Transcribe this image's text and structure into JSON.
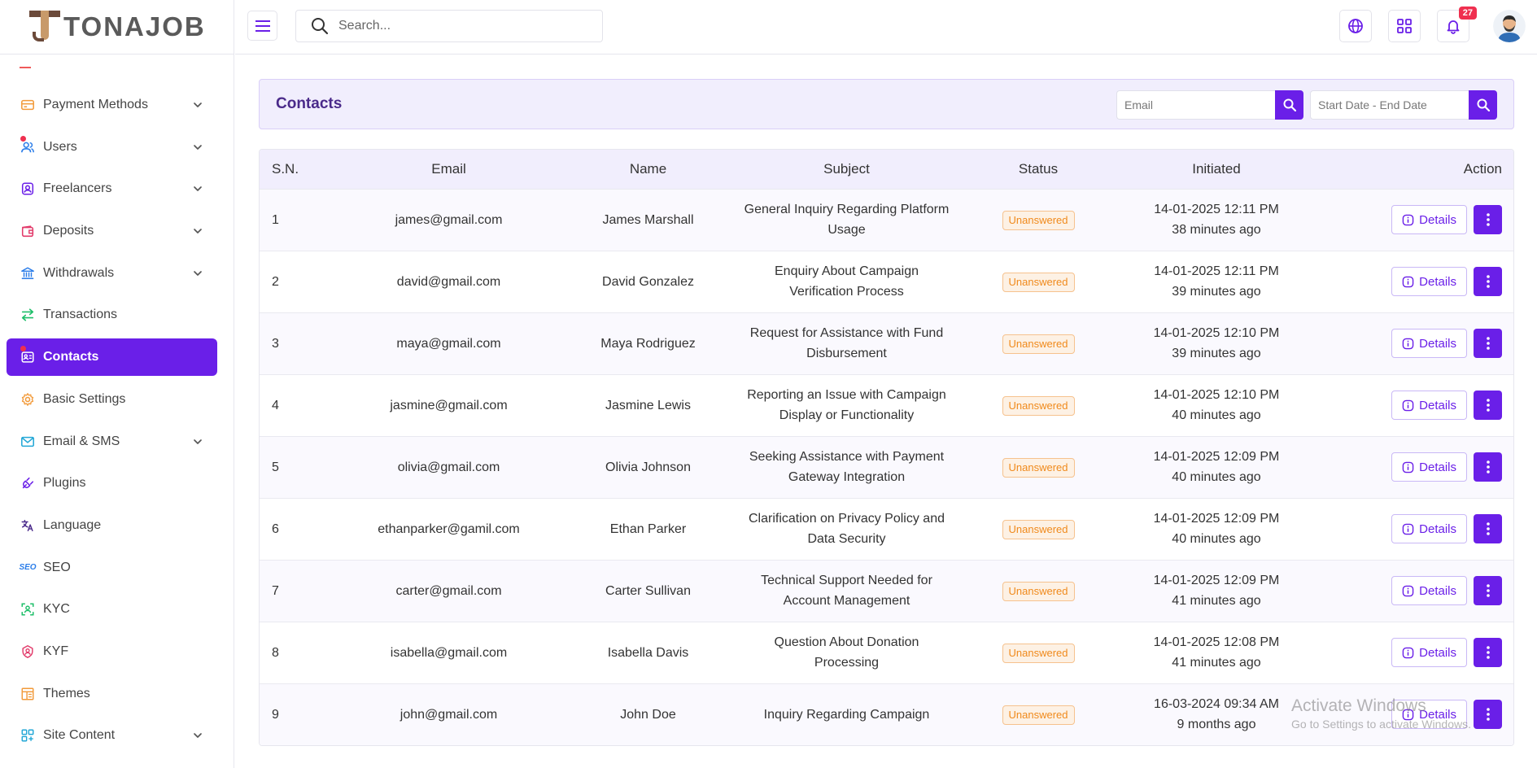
{
  "brand": {
    "logo_text": "TONAJOB"
  },
  "topbar": {
    "search_placeholder": "Search...",
    "notification_count": "27"
  },
  "sidebar": {
    "items": [
      {
        "label": "Payment Methods",
        "icon": "credit-card-icon",
        "chevron": true,
        "active": false,
        "dot": false
      },
      {
        "label": "Users",
        "icon": "users-icon",
        "chevron": true,
        "active": false,
        "dot": true
      },
      {
        "label": "Freelancers",
        "icon": "freelancer-icon",
        "chevron": true,
        "active": false,
        "dot": false
      },
      {
        "label": "Deposits",
        "icon": "wallet-icon",
        "chevron": true,
        "active": false,
        "dot": false
      },
      {
        "label": "Withdrawals",
        "icon": "bank-icon",
        "chevron": true,
        "active": false,
        "dot": false
      },
      {
        "label": "Transactions",
        "icon": "transfer-icon",
        "chevron": false,
        "active": false,
        "dot": false
      },
      {
        "label": "Contacts",
        "icon": "contact-icon",
        "chevron": false,
        "active": true,
        "dot": true
      },
      {
        "label": "Basic Settings",
        "icon": "gear-icon",
        "chevron": false,
        "active": false,
        "dot": false
      },
      {
        "label": "Email & SMS",
        "icon": "mail-icon",
        "chevron": true,
        "active": false,
        "dot": false
      },
      {
        "label": "Plugins",
        "icon": "plug-icon",
        "chevron": false,
        "active": false,
        "dot": false
      },
      {
        "label": "Language",
        "icon": "translate-icon",
        "chevron": false,
        "active": false,
        "dot": false
      },
      {
        "label": "SEO",
        "icon": "seo-icon",
        "chevron": false,
        "active": false,
        "dot": false,
        "icon_text": "SEO"
      },
      {
        "label": "KYC",
        "icon": "scan-icon",
        "chevron": false,
        "active": false,
        "dot": false
      },
      {
        "label": "KYF",
        "icon": "badge-icon",
        "chevron": false,
        "active": false,
        "dot": false
      },
      {
        "label": "Themes",
        "icon": "layout-icon",
        "chevron": false,
        "active": false,
        "dot": false
      },
      {
        "label": "Site Content",
        "icon": "grid-icon",
        "chevron": true,
        "active": false,
        "dot": false
      }
    ]
  },
  "panel": {
    "title": "Contacts",
    "email_placeholder": "Email",
    "date_placeholder": "Start Date - End Date"
  },
  "table": {
    "headers": {
      "sn": "S.N.",
      "email": "Email",
      "name": "Name",
      "subject": "Subject",
      "status": "Status",
      "initiated": "Initiated",
      "action": "Action"
    },
    "details_label": "Details",
    "rows": [
      {
        "sn": "1",
        "email": "james@gmail.com",
        "name": "James Marshall",
        "subject_1": "General Inquiry Regarding Platform",
        "subject_2": "Usage",
        "status": "Unanswered",
        "date": "14-01-2025 12:11 PM",
        "ago": "38 minutes ago"
      },
      {
        "sn": "2",
        "email": "david@gmail.com",
        "name": "David Gonzalez",
        "subject_1": "Enquiry About Campaign",
        "subject_2": "Verification Process",
        "status": "Unanswered",
        "date": "14-01-2025 12:11 PM",
        "ago": "39 minutes ago"
      },
      {
        "sn": "3",
        "email": "maya@gmail.com",
        "name": "Maya Rodriguez",
        "subject_1": "Request for Assistance with Fund",
        "subject_2": "Disbursement",
        "status": "Unanswered",
        "date": "14-01-2025 12:10 PM",
        "ago": "39 minutes ago"
      },
      {
        "sn": "4",
        "email": "jasmine@gmail.com",
        "name": "Jasmine Lewis",
        "subject_1": "Reporting an Issue with Campaign",
        "subject_2": "Display or Functionality",
        "status": "Unanswered",
        "date": "14-01-2025 12:10 PM",
        "ago": "40 minutes ago"
      },
      {
        "sn": "5",
        "email": "olivia@gmail.com",
        "name": "Olivia Johnson",
        "subject_1": "Seeking Assistance with Payment",
        "subject_2": "Gateway Integration",
        "status": "Unanswered",
        "date": "14-01-2025 12:09 PM",
        "ago": "40 minutes ago"
      },
      {
        "sn": "6",
        "email": "ethanparker@gamil.com",
        "name": "Ethan Parker",
        "subject_1": "Clarification on Privacy Policy and",
        "subject_2": "Data Security",
        "status": "Unanswered",
        "date": "14-01-2025 12:09 PM",
        "ago": "40 minutes ago"
      },
      {
        "sn": "7",
        "email": "carter@gmail.com",
        "name": "Carter Sullivan",
        "subject_1": "Technical Support Needed for",
        "subject_2": "Account Management",
        "status": "Unanswered",
        "date": "14-01-2025 12:09 PM",
        "ago": "41 minutes ago"
      },
      {
        "sn": "8",
        "email": "isabella@gmail.com",
        "name": "Isabella Davis",
        "subject_1": "Question About Donation",
        "subject_2": "Processing",
        "status": "Unanswered",
        "date": "14-01-2025 12:08 PM",
        "ago": "41 minutes ago"
      },
      {
        "sn": "9",
        "email": "john@gmail.com",
        "name": "John Doe",
        "subject_1": "Inquiry Regarding Campaign",
        "subject_2": "",
        "status": "Unanswered",
        "date": "16-03-2024 09:34 AM",
        "ago": "9 months ago"
      }
    ]
  },
  "watermark": {
    "line1": "Activate Windows",
    "line2": "Go to Settings to activate Windows."
  },
  "colors": {
    "accent": "#6a1fe8",
    "status_text": "#f08a1c",
    "badge": "#ef2f4f"
  }
}
